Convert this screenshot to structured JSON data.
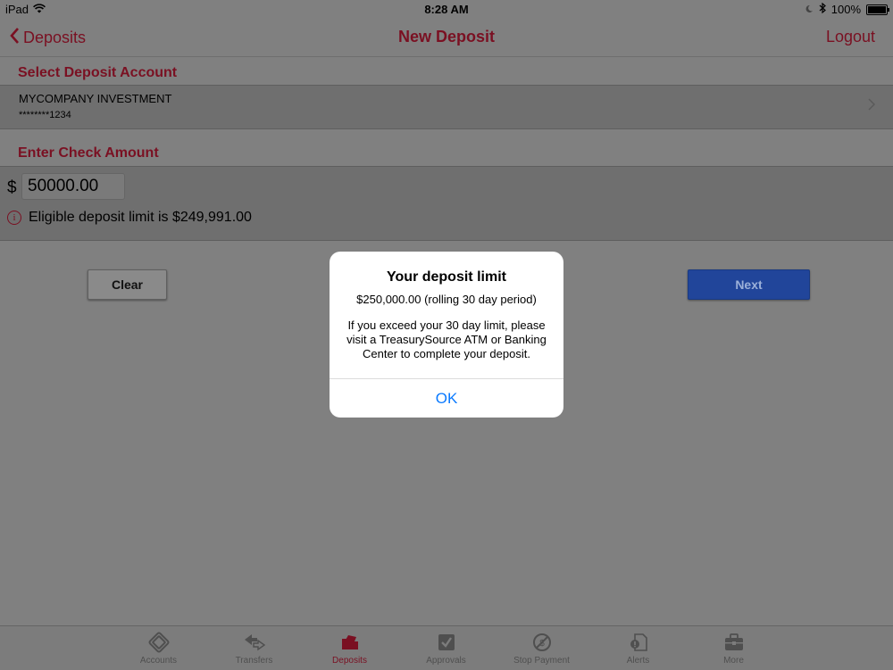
{
  "status_bar": {
    "device": "iPad",
    "time": "8:28 AM",
    "battery": "100%"
  },
  "nav": {
    "back_label": "Deposits",
    "title": "New Deposit",
    "logout_label": "Logout"
  },
  "account_section": {
    "header": "Select Deposit Account",
    "account_name": "MYCOMPANY INVESTMENT",
    "account_number": "********1234"
  },
  "amount_section": {
    "header": "Enter Check Amount",
    "currency_symbol": "$",
    "amount_value": "50000.00",
    "eligible_text": "Eligible deposit limit is $249,991.00"
  },
  "buttons": {
    "clear_label": "Clear",
    "next_label": "Next"
  },
  "modal": {
    "title": "Your deposit limit",
    "limit": "$250,000.00 (rolling 30 day period)",
    "message": "If you exceed your 30 day limit, please visit a TreasurySource ATM or Banking Center to complete your deposit.",
    "ok_label": "OK"
  },
  "tabs": [
    {
      "label": "Accounts",
      "icon": "accounts-icon",
      "active": false
    },
    {
      "label": "Transfers",
      "icon": "transfers-icon",
      "active": false
    },
    {
      "label": "Deposits",
      "icon": "deposits-icon",
      "active": true
    },
    {
      "label": "Approvals",
      "icon": "approvals-icon",
      "active": false
    },
    {
      "label": "Stop Payment",
      "icon": "stop-payment-icon",
      "active": false
    },
    {
      "label": "Alerts",
      "icon": "alerts-icon",
      "active": false
    },
    {
      "label": "More",
      "icon": "more-icon",
      "active": false
    }
  ],
  "colors": {
    "accent": "#7a1022",
    "next_button": "#21459a",
    "dim_background": "#808080",
    "ok_link": "#0a7aff"
  }
}
